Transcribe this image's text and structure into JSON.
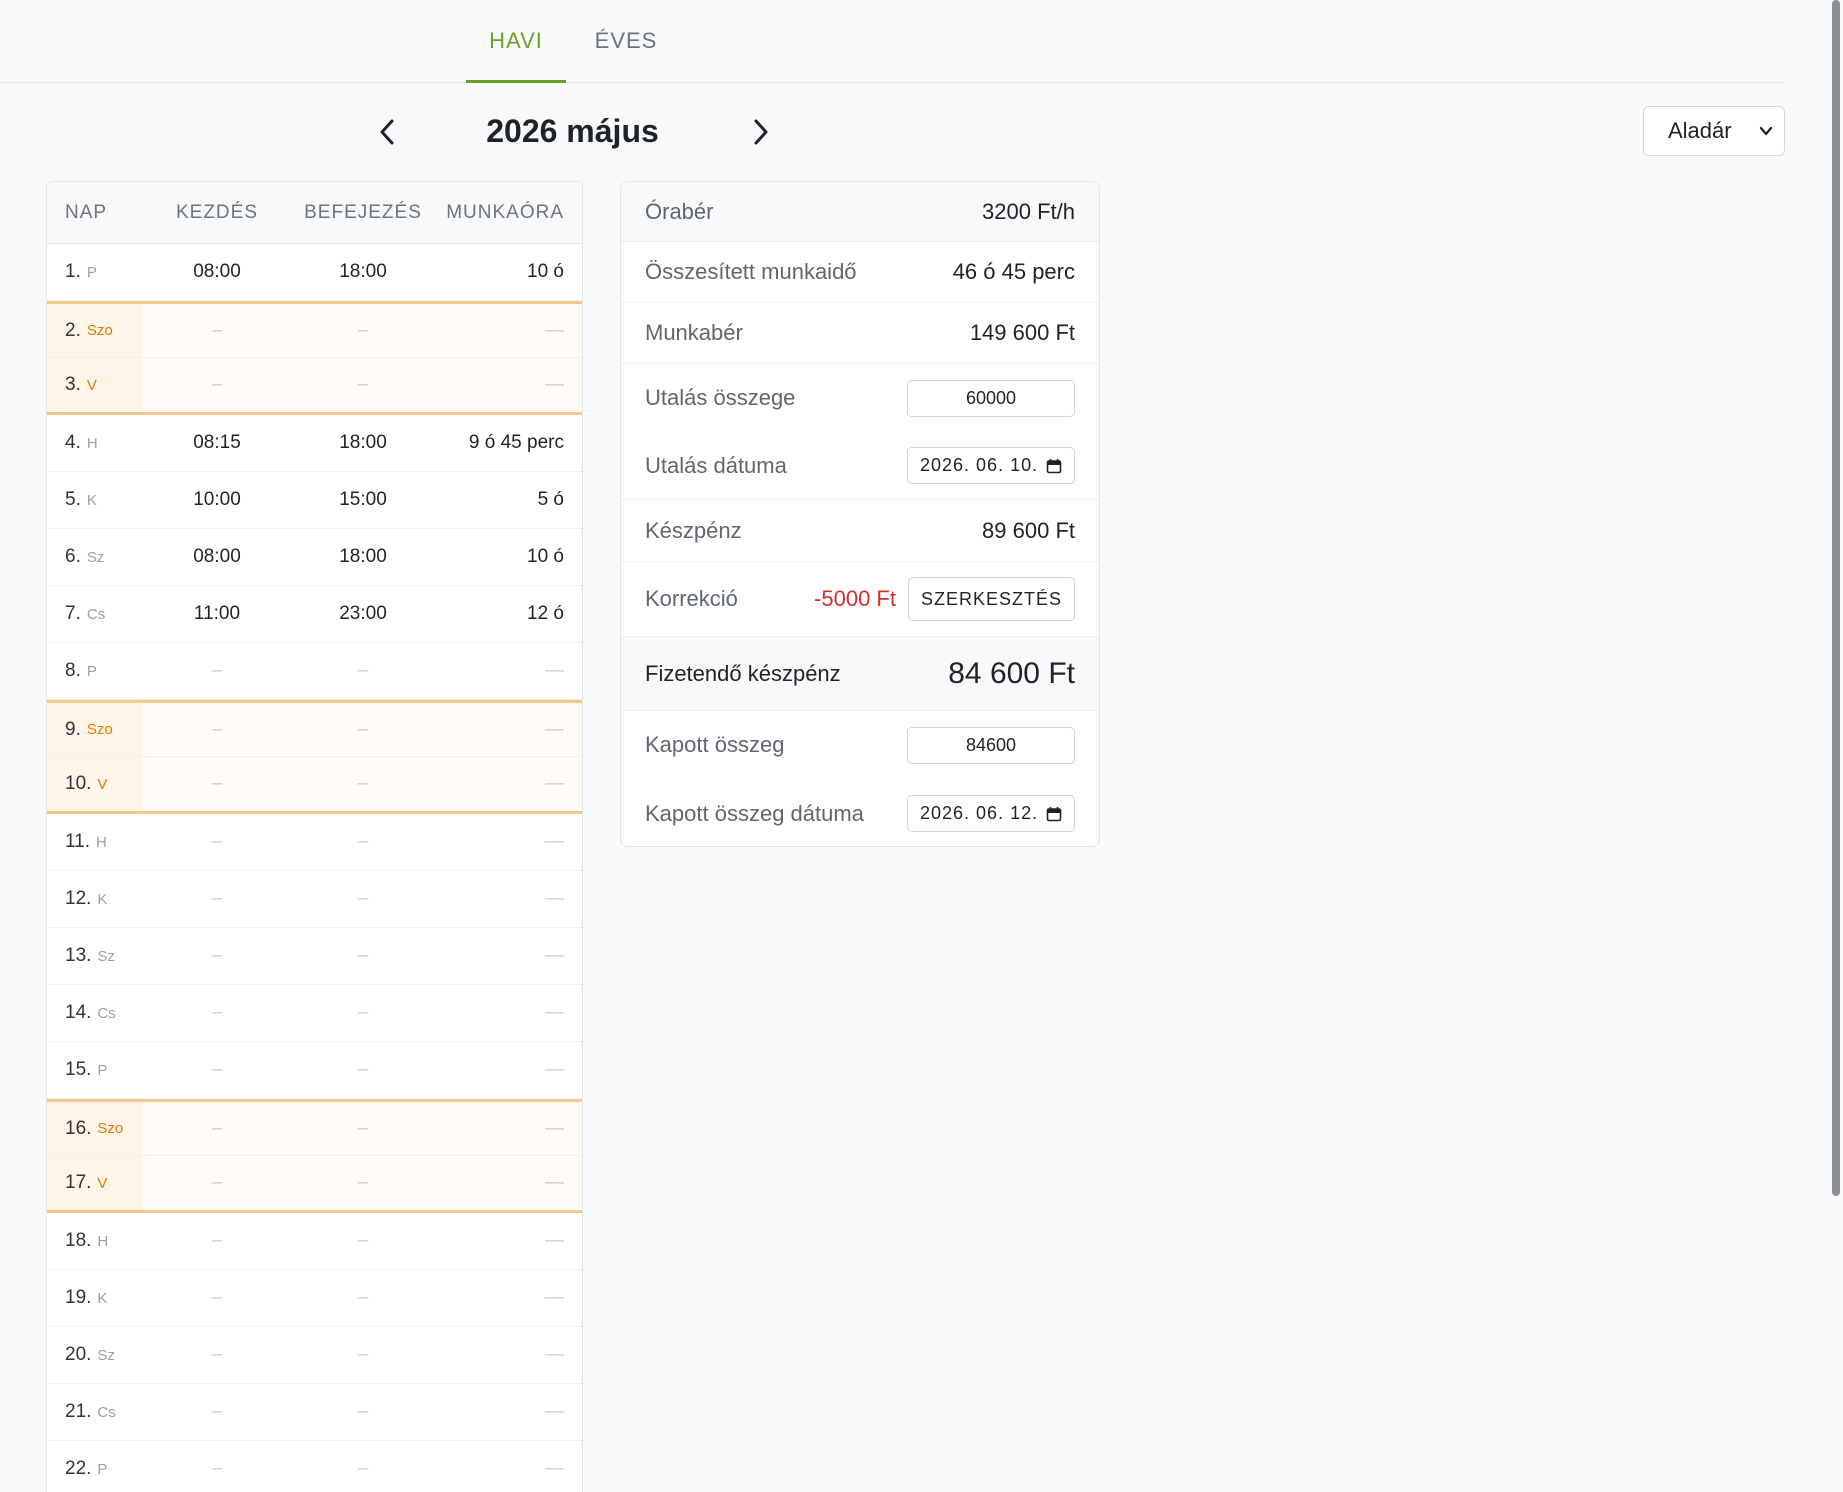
{
  "tabs": [
    {
      "label": "HAVI",
      "active": true
    },
    {
      "label": "ÉVES",
      "active": false
    }
  ],
  "month_nav": {
    "title": "2026 május",
    "prev_icon": "chevron-left-icon",
    "next_icon": "chevron-right-icon"
  },
  "person_select": {
    "value": "Aladár",
    "icon": "chevron-down-icon"
  },
  "days_table": {
    "headers": {
      "day": "NAP",
      "start": "KEZDÉS",
      "end": "BEFEJEZÉS",
      "hours": "MUNKAÓRA"
    },
    "rows": [
      {
        "num": "1.",
        "abbr": "P",
        "start": "08:00",
        "end": "18:00",
        "hours": "10 ó",
        "weekend": false
      },
      {
        "num": "2.",
        "abbr": "Szo",
        "start": "–",
        "end": "–",
        "hours": "—",
        "weekend": true
      },
      {
        "num": "3.",
        "abbr": "V",
        "start": "–",
        "end": "–",
        "hours": "—",
        "weekend": true
      },
      {
        "num": "4.",
        "abbr": "H",
        "start": "08:15",
        "end": "18:00",
        "hours": "9 ó 45 perc",
        "weekend": false
      },
      {
        "num": "5.",
        "abbr": "K",
        "start": "10:00",
        "end": "15:00",
        "hours": "5 ó",
        "weekend": false
      },
      {
        "num": "6.",
        "abbr": "Sz",
        "start": "08:00",
        "end": "18:00",
        "hours": "10 ó",
        "weekend": false
      },
      {
        "num": "7.",
        "abbr": "Cs",
        "start": "11:00",
        "end": "23:00",
        "hours": "12 ó",
        "weekend": false
      },
      {
        "num": "8.",
        "abbr": "P",
        "start": "–",
        "end": "–",
        "hours": "—",
        "weekend": false
      },
      {
        "num": "9.",
        "abbr": "Szo",
        "start": "–",
        "end": "–",
        "hours": "—",
        "weekend": true
      },
      {
        "num": "10.",
        "abbr": "V",
        "start": "–",
        "end": "–",
        "hours": "—",
        "weekend": true
      },
      {
        "num": "11.",
        "abbr": "H",
        "start": "–",
        "end": "–",
        "hours": "—",
        "weekend": false
      },
      {
        "num": "12.",
        "abbr": "K",
        "start": "–",
        "end": "–",
        "hours": "—",
        "weekend": false
      },
      {
        "num": "13.",
        "abbr": "Sz",
        "start": "–",
        "end": "–",
        "hours": "—",
        "weekend": false
      },
      {
        "num": "14.",
        "abbr": "Cs",
        "start": "–",
        "end": "–",
        "hours": "—",
        "weekend": false
      },
      {
        "num": "15.",
        "abbr": "P",
        "start": "–",
        "end": "–",
        "hours": "—",
        "weekend": false
      },
      {
        "num": "16.",
        "abbr": "Szo",
        "start": "–",
        "end": "–",
        "hours": "—",
        "weekend": true
      },
      {
        "num": "17.",
        "abbr": "V",
        "start": "–",
        "end": "–",
        "hours": "—",
        "weekend": true
      },
      {
        "num": "18.",
        "abbr": "H",
        "start": "–",
        "end": "–",
        "hours": "—",
        "weekend": false
      },
      {
        "num": "19.",
        "abbr": "K",
        "start": "–",
        "end": "–",
        "hours": "—",
        "weekend": false
      },
      {
        "num": "20.",
        "abbr": "Sz",
        "start": "–",
        "end": "–",
        "hours": "—",
        "weekend": false
      },
      {
        "num": "21.",
        "abbr": "Cs",
        "start": "–",
        "end": "–",
        "hours": "—",
        "weekend": false
      },
      {
        "num": "22.",
        "abbr": "P",
        "start": "–",
        "end": "–",
        "hours": "—",
        "weekend": false
      }
    ]
  },
  "summary": {
    "hourly_rate": {
      "label": "Órabér",
      "value": "3200 Ft/h"
    },
    "total_time": {
      "label": "Összesített munkaidő",
      "value": "46 ó 45 perc"
    },
    "wage": {
      "label": "Munkabér",
      "value": "149 600 Ft"
    },
    "transfer_amount": {
      "label": "Utalás összege",
      "value": "60000"
    },
    "transfer_date": {
      "label": "Utalás dátuma",
      "value": "2026. 06. 10."
    },
    "cash": {
      "label": "Készpénz",
      "value": "89 600 Ft"
    },
    "correction": {
      "label": "Korrekció",
      "value": "-5000 Ft",
      "button": "SZERKESZTÉS"
    },
    "payable_cash": {
      "label": "Fizetendő készpénz",
      "value": "84 600 Ft"
    },
    "received_amount": {
      "label": "Kapott összeg",
      "value": "84600"
    },
    "received_date": {
      "label": "Kapott összeg dátuma",
      "value": "2026. 06. 12."
    }
  },
  "colors": {
    "accent": "#6b9f2c",
    "weekend": "#e07b00",
    "negative": "#d32f2f"
  }
}
